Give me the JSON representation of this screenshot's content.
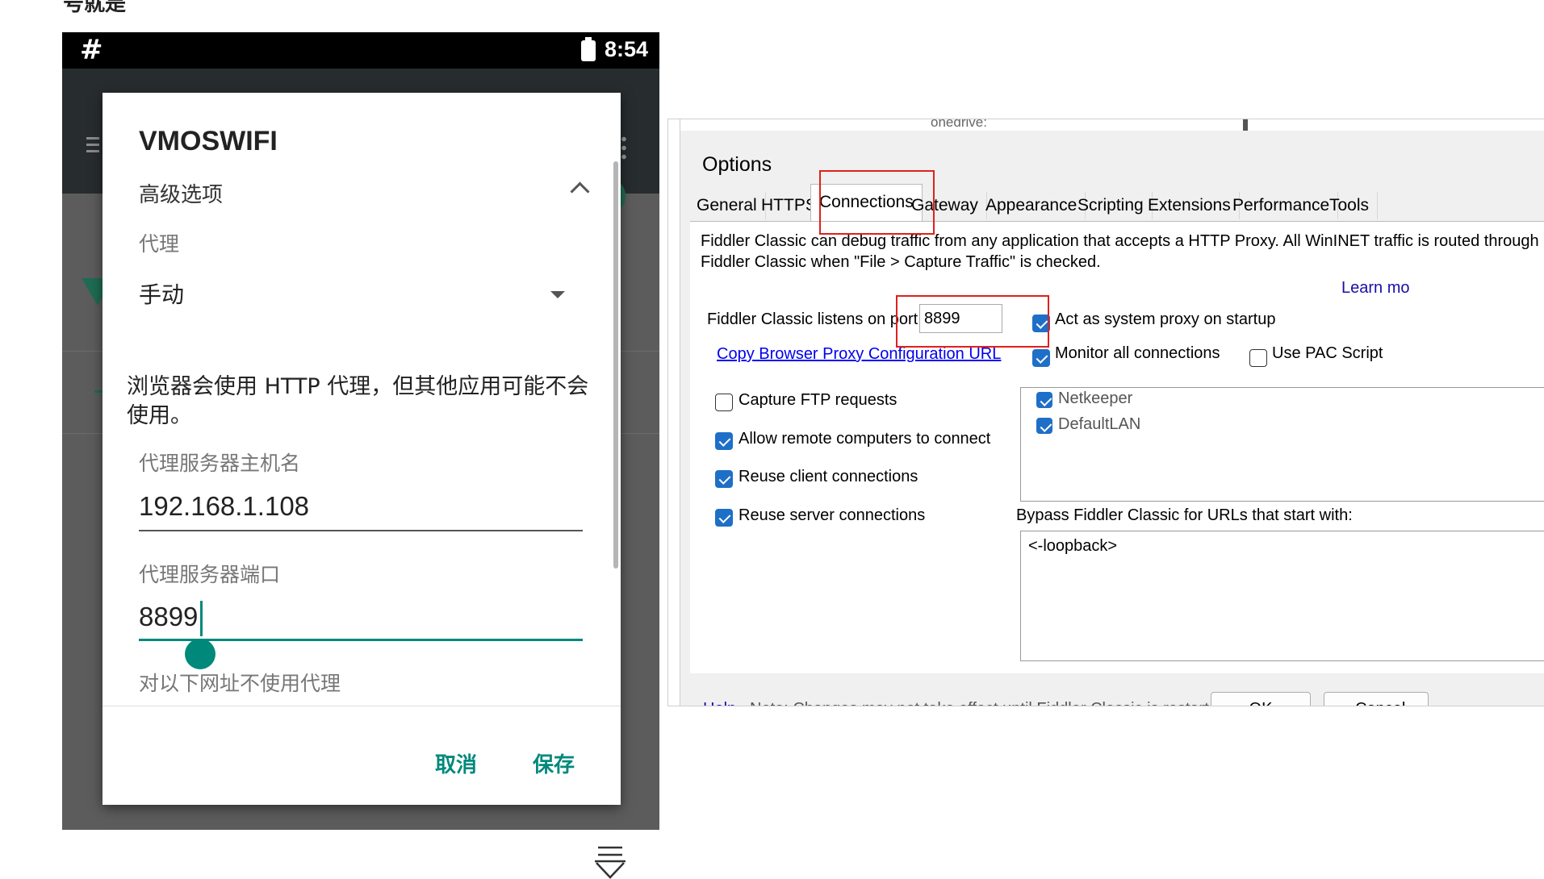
{
  "top_heading": "号就是",
  "android": {
    "status": {
      "hash": "#",
      "time": "8:54"
    },
    "dialog": {
      "title": "VMOSWIFI",
      "advanced_options": "高级选项",
      "proxy_label": "代理",
      "proxy_value": "手动",
      "warning": "浏览器会使用 HTTP 代理，但其他应用可能不会使用。",
      "host_label": "代理服务器主机名",
      "host_value": "192.168.1.108",
      "port_label": "代理服务器端口",
      "port_value": "8899",
      "bypass_label": "对以下网址不使用代理",
      "cancel": "取消",
      "save": "保存"
    },
    "colors": {
      "accent": "#00897b"
    }
  },
  "fiddler": {
    "background_hint": "onedrive:",
    "title": "Options",
    "tabs": [
      "General",
      "HTTPS",
      "Connections",
      "Gateway",
      "Appearance",
      "Scripting",
      "Extensions",
      "Performance",
      "Tools"
    ],
    "active_tab": "Connections",
    "description": "Fiddler Classic can debug traffic from any application that accepts a HTTP Proxy. All WinINET traffic is routed through Fiddler Classic when \"File > Capture Traffic\" is checked.",
    "learn_more": "Learn mo",
    "port_label": "Fiddler Classic listens on port:",
    "port_value": "8899",
    "copy_link": "Copy Browser Proxy Configuration URL",
    "left_options": [
      {
        "label": "Capture FTP requests",
        "checked": false
      },
      {
        "label": "Allow remote computers to connect",
        "checked": true
      },
      {
        "label": "Reuse client connections",
        "checked": true
      },
      {
        "label": "Reuse server connections",
        "checked": true
      }
    ],
    "right_options": [
      {
        "label": "Act as system proxy on startup",
        "checked": true
      },
      {
        "label": "Monitor all connections",
        "checked": true
      },
      {
        "label": "Use PAC Script",
        "checked": false
      }
    ],
    "connections": [
      {
        "label": "Netkeeper",
        "checked": true
      },
      {
        "label": "DefaultLAN",
        "checked": true
      }
    ],
    "bypass_label": "Bypass Fiddler Classic for URLs that start with:",
    "bypass_value": "<-loopback>",
    "help": "Help",
    "note": "Note: Changes may not take effect until Fiddler Classic is restarted.",
    "ok": "OK",
    "cancel": "Cancel",
    "colors": {
      "highlight": "#e0201c",
      "check": "#1e6fc7"
    }
  }
}
